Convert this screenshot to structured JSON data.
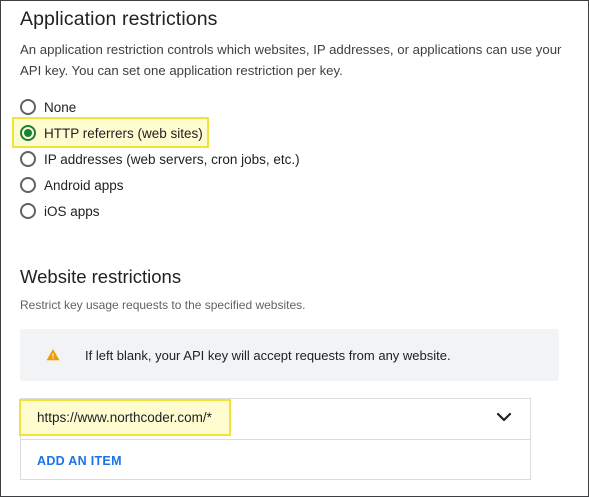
{
  "app_restrictions": {
    "title": "Application restrictions",
    "description": "An application restriction controls which websites, IP addresses, or applications can use your API key. You can set one application restriction per key.",
    "options": [
      {
        "label": "None",
        "selected": false
      },
      {
        "label": "HTTP referrers (web sites)",
        "selected": true
      },
      {
        "label": "IP addresses (web servers, cron jobs, etc.)",
        "selected": false
      },
      {
        "label": "Android apps",
        "selected": false
      },
      {
        "label": "iOS apps",
        "selected": false
      }
    ]
  },
  "website_restrictions": {
    "title": "Website restrictions",
    "subtitle": "Restrict key usage requests to the specified websites.",
    "notice": {
      "icon": "warning-icon",
      "text": "If left blank, your API key will accept requests from any website."
    },
    "items": [
      {
        "value": "https://www.northcoder.com/*"
      }
    ],
    "add_item_label": "ADD AN ITEM"
  },
  "colors": {
    "selected_radio": "#188038",
    "link": "#1a73e8",
    "warning": "#f29900",
    "highlight": "#f2e33a"
  }
}
